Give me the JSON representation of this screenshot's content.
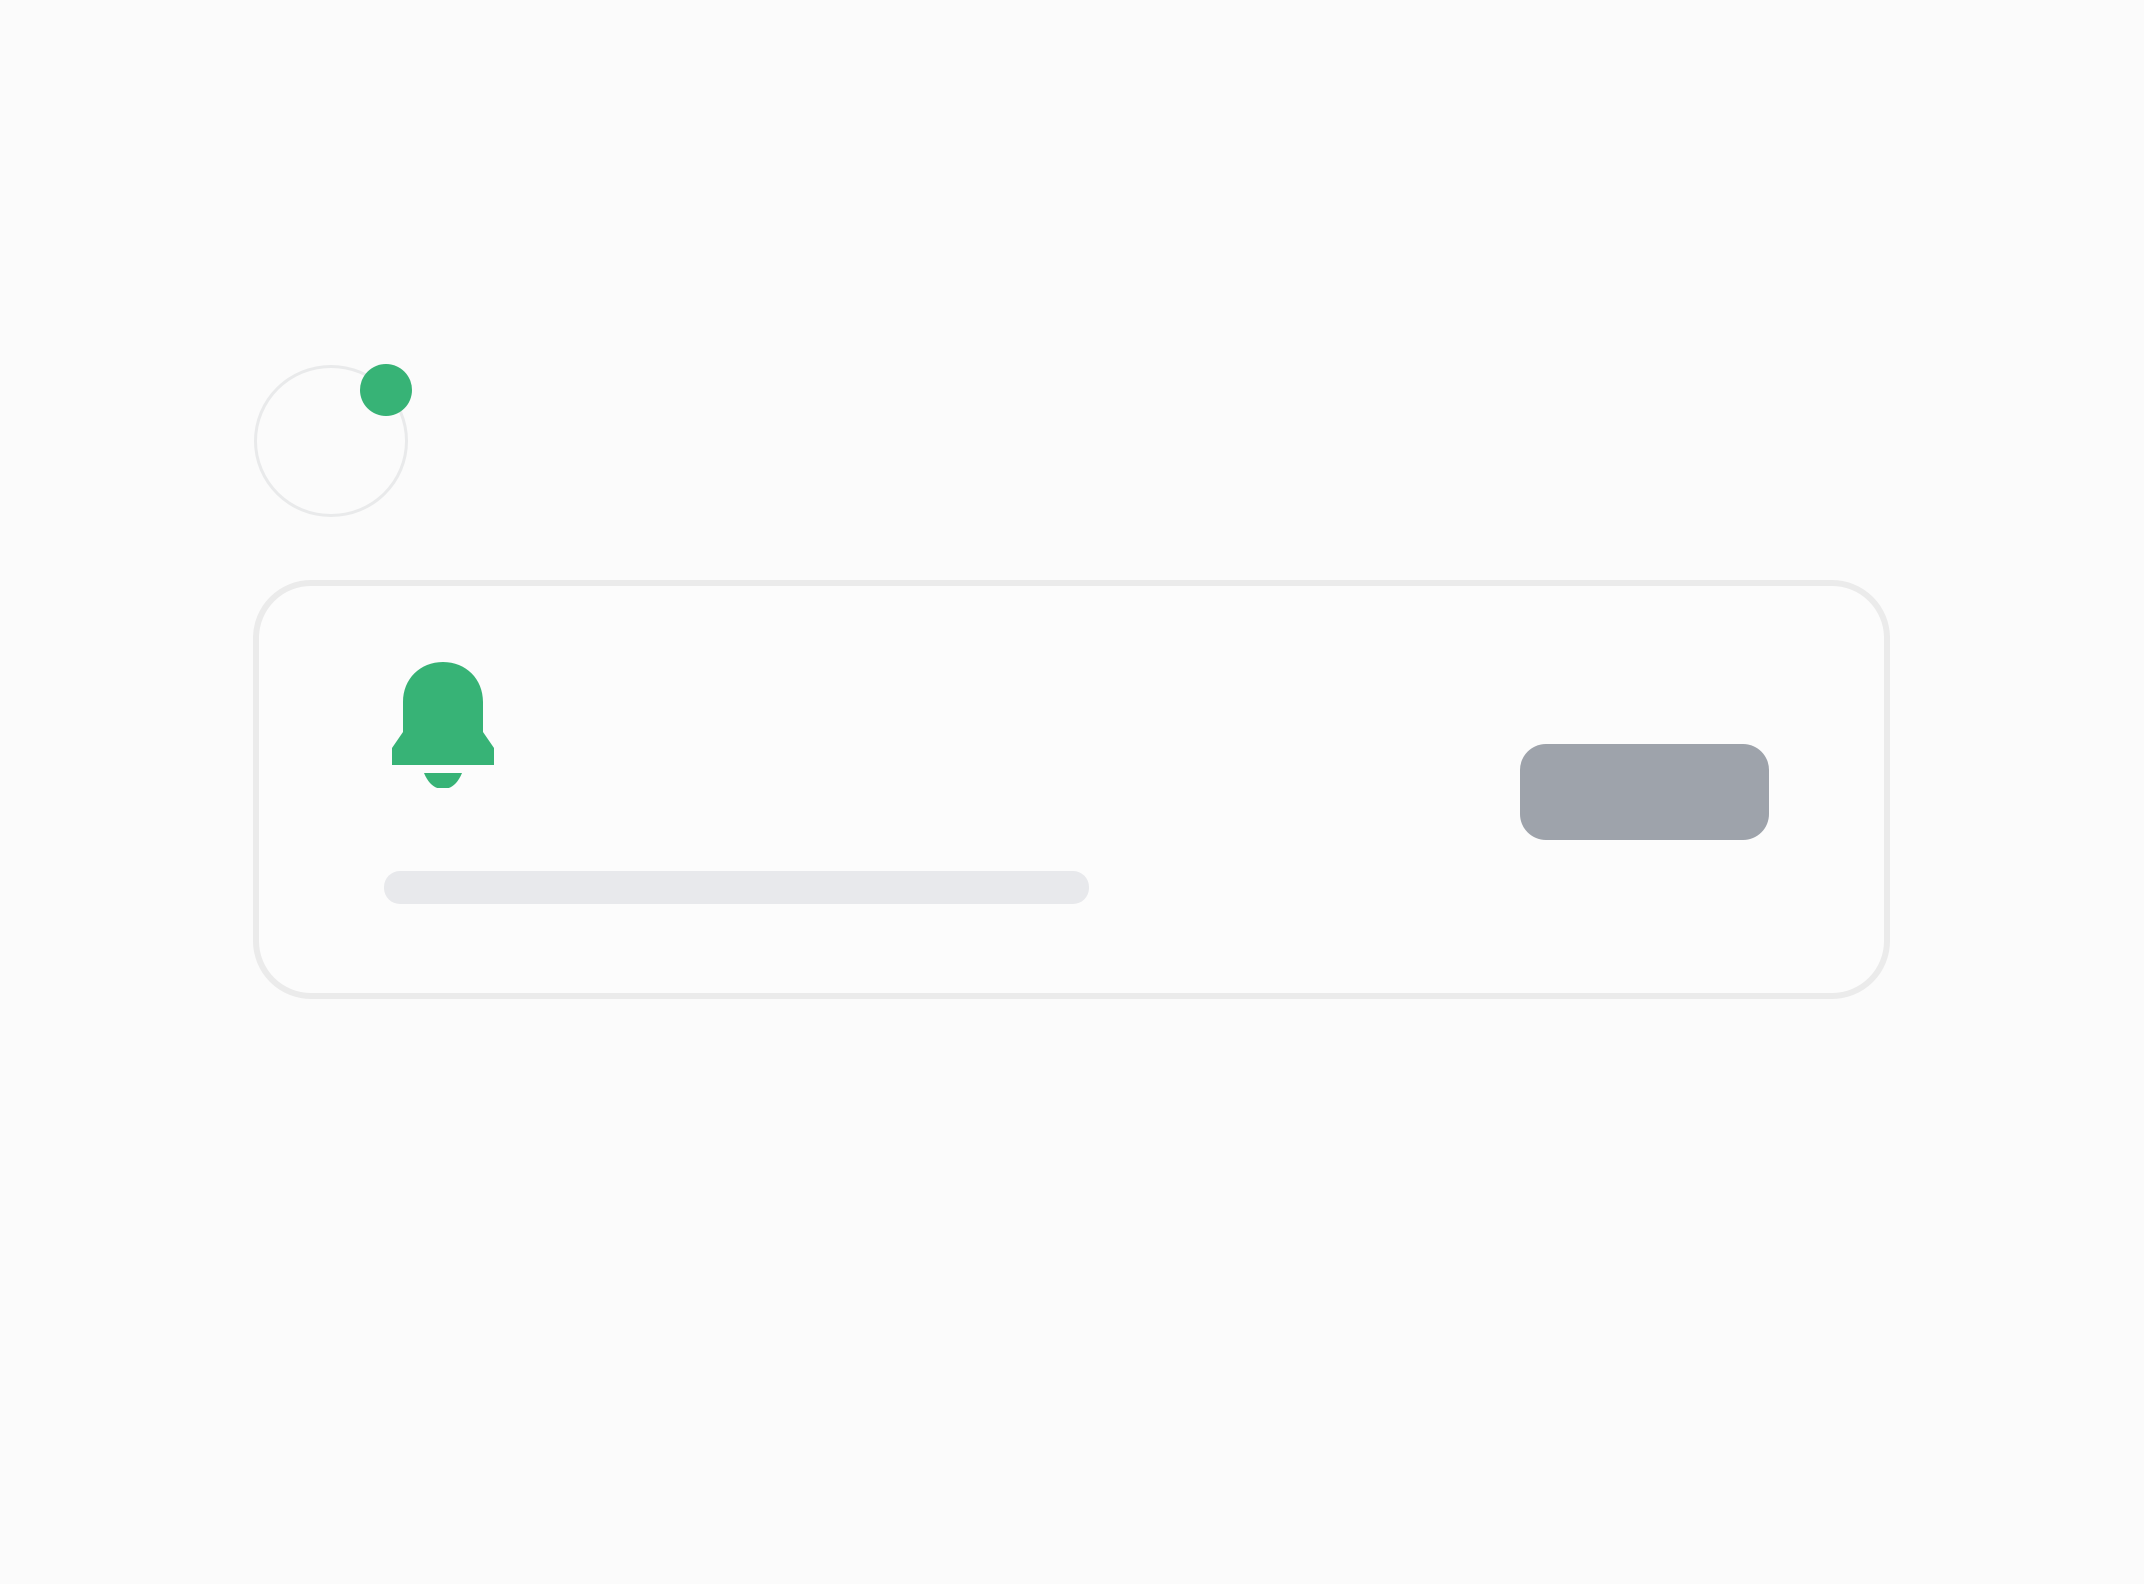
{
  "colors": {
    "accent": "#37b376",
    "button": "#9ea3ab",
    "skeleton": "#e8e9ec",
    "border": "#ebebeb",
    "background": "#fbfbfb"
  },
  "avatar": {
    "status": "online"
  },
  "notification": {
    "icon": "bell-icon",
    "message": "",
    "button_label": ""
  }
}
